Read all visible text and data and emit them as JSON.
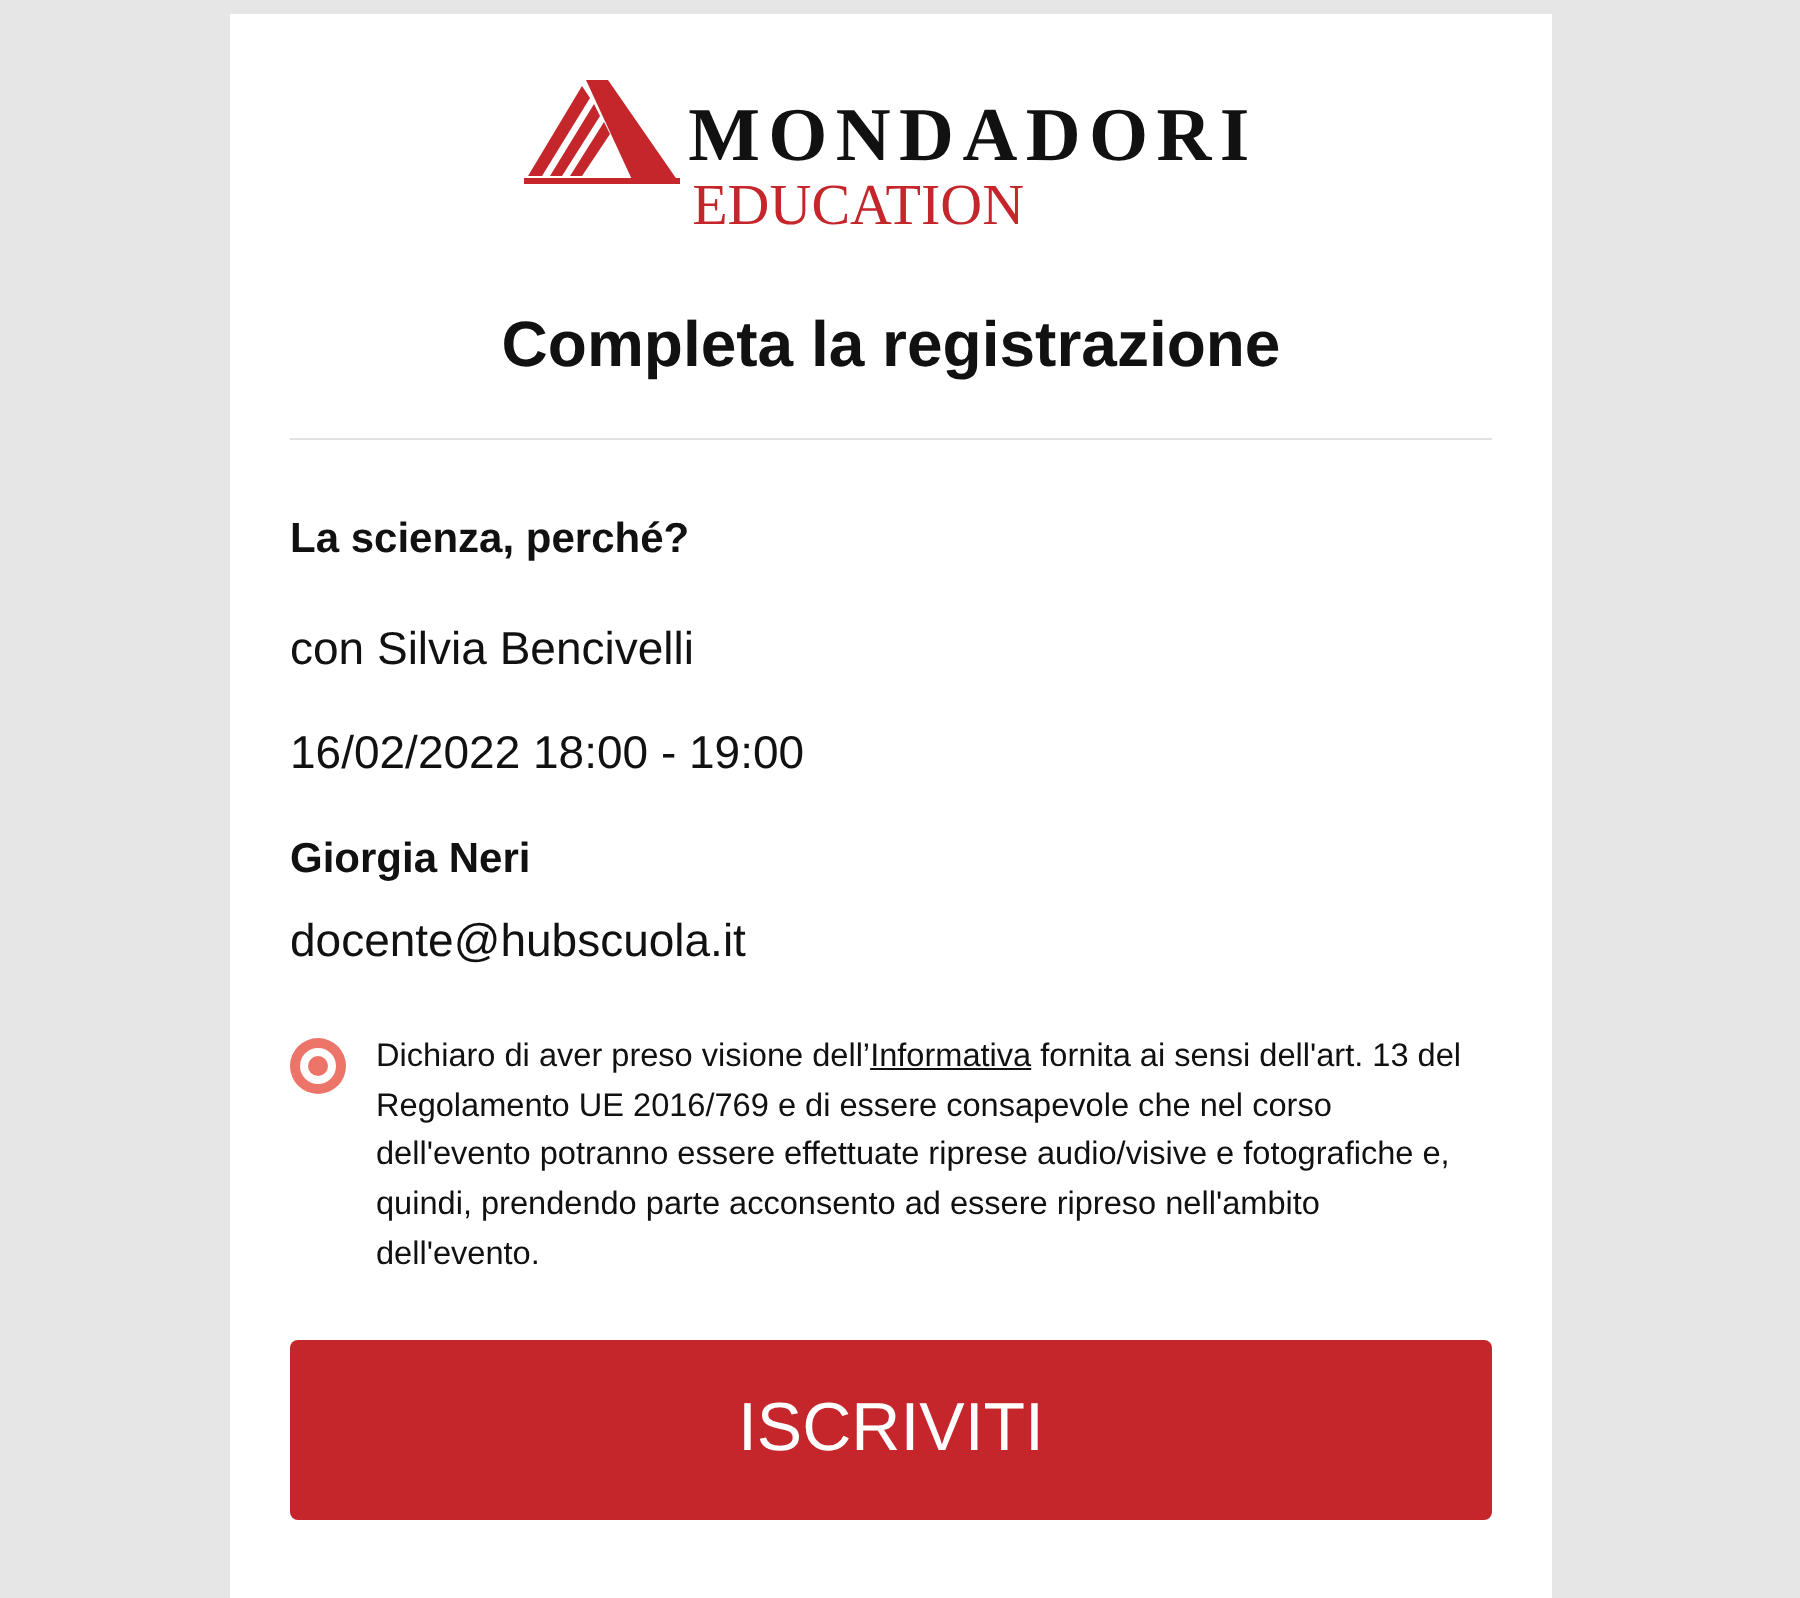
{
  "logo": {
    "name": "MONDADORI",
    "subtitle": "EDUCATION"
  },
  "title": "Completa la registrazione",
  "event": {
    "title": "La scienza, perché?",
    "speaker": "con Silvia Bencivelli",
    "datetime": "16/02/2022 18:00 - 19:00"
  },
  "user": {
    "name": "Giorgia Neri",
    "email": "docente@hubscuola.it"
  },
  "consent": {
    "checked": true,
    "text_before": "Dichiaro di aver preso visione dell’",
    "link": "Informativa",
    "text_after": " fornita ai sensi dell'art. 13 del Regolamento UE 2016/769 e di essere consapevole che nel corso dell'evento potranno essere effettuate riprese audio/visive e fotografiche e, quindi, prendendo parte acconsento ad essere ripreso nell'ambito dell'evento."
  },
  "submit_button": {
    "label": "ISCRIVITI"
  }
}
